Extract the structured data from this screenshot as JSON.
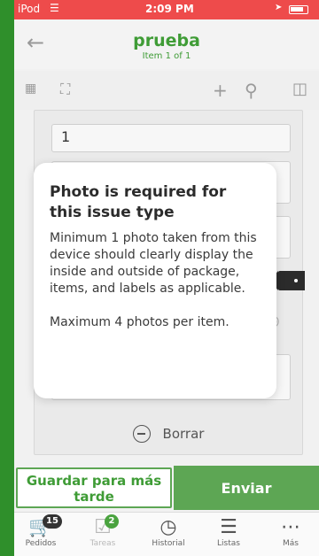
{
  "statusbar": {
    "carrier": "iPod",
    "time": "2:09 PM"
  },
  "header": {
    "title": "prueba",
    "subtitle": "Item 1 of 1"
  },
  "form": {
    "quantity_value": "1",
    "delete_label": "Borrar"
  },
  "tooltip": {
    "heading": "Photo is required for this issue type",
    "body": "Minimum 1 photo taken from this device should clearly display the inside and outside of package, items, and labels as applicable.",
    "note": "Maximum 4 photos per item."
  },
  "actions": {
    "save_later": "Guardar para más tarde",
    "send": "Enviar"
  },
  "tabbar": {
    "items": [
      {
        "label": "Pedidos",
        "badge": "15",
        "icon": "cart-icon"
      },
      {
        "label": "Tareas",
        "badge": "2",
        "icon": "tasks-icon"
      },
      {
        "label": "Historial",
        "icon": "clock-icon"
      },
      {
        "label": "Listas",
        "icon": "list-icon"
      },
      {
        "label": "Más",
        "icon": "more-icon"
      }
    ]
  },
  "colors": {
    "brand_green": "#3f9c36",
    "status_red": "#ee4b4b",
    "outer_green": "#2f8f2b"
  }
}
